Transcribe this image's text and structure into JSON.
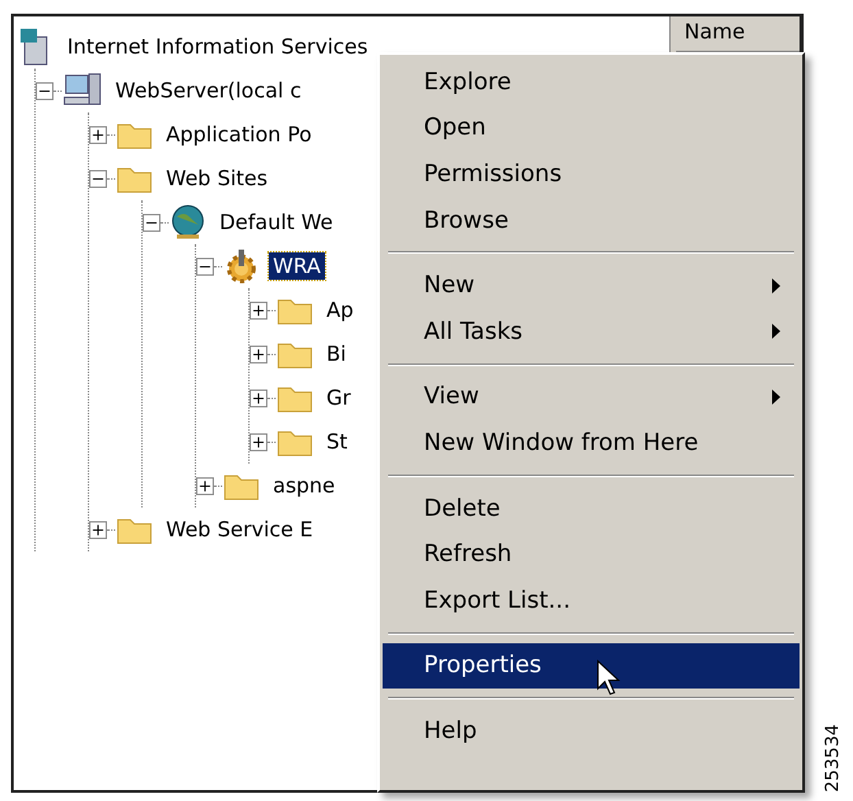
{
  "tree": {
    "label": "Internet Information Services",
    "kind": "services",
    "children": [
      {
        "label": "WebServer(local c",
        "kind": "server",
        "expanded": true,
        "selected": false,
        "children": [
          {
            "label": "Application Po",
            "kind": "folder",
            "expanded": false,
            "selected": false
          },
          {
            "label": "Web Sites",
            "kind": "folder",
            "expanded": true,
            "selected": false,
            "children": [
              {
                "label": "Default We",
                "kind": "website",
                "expanded": true,
                "selected": false,
                "children": [
                  {
                    "label": "WRA",
                    "kind": "app",
                    "expanded": true,
                    "selected": true,
                    "children": [
                      {
                        "label": "Ap",
                        "kind": "folder",
                        "expanded": false,
                        "selected": false
                      },
                      {
                        "label": "Bi",
                        "kind": "folder",
                        "expanded": false,
                        "selected": false
                      },
                      {
                        "label": "Gr",
                        "kind": "folder",
                        "expanded": false,
                        "selected": false
                      },
                      {
                        "label": "St",
                        "kind": "folder",
                        "expanded": false,
                        "selected": false
                      }
                    ]
                  },
                  {
                    "label": "aspne",
                    "kind": "folder",
                    "expanded": false,
                    "selected": false
                  }
                ]
              }
            ]
          },
          {
            "label": "Web Service E",
            "kind": "folder",
            "expanded": false,
            "selected": false
          }
        ]
      }
    ]
  },
  "list_header": {
    "column_1": "Name"
  },
  "context_menu": {
    "groups": [
      [
        {
          "label": "Explore",
          "submenu": false,
          "selected": false
        },
        {
          "label": "Open",
          "submenu": false,
          "selected": false
        },
        {
          "label": "Permissions",
          "submenu": false,
          "selected": false
        },
        {
          "label": "Browse",
          "submenu": false,
          "selected": false
        }
      ],
      [
        {
          "label": "New",
          "submenu": true,
          "selected": false
        },
        {
          "label": "All Tasks",
          "submenu": true,
          "selected": false
        }
      ],
      [
        {
          "label": "View",
          "submenu": true,
          "selected": false
        },
        {
          "label": "New Window from Here",
          "submenu": false,
          "selected": false
        }
      ],
      [
        {
          "label": "Delete",
          "submenu": false,
          "selected": false
        },
        {
          "label": "Refresh",
          "submenu": false,
          "selected": false
        },
        {
          "label": "Export List...",
          "submenu": false,
          "selected": false
        }
      ],
      [
        {
          "label": "Properties",
          "submenu": false,
          "selected": true
        }
      ],
      [
        {
          "label": "Help",
          "submenu": false,
          "selected": false
        }
      ]
    ]
  },
  "figure_number": "253534"
}
